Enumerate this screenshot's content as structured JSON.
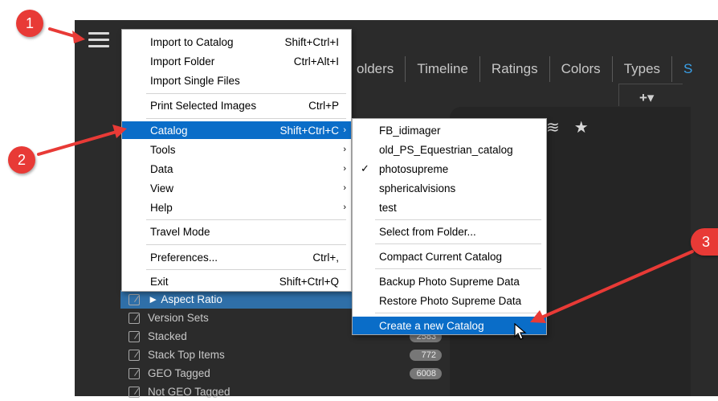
{
  "app": {
    "tabs": [
      "olders",
      "Timeline",
      "Ratings",
      "Colors",
      "Types",
      "S"
    ],
    "plus_label": "+▾"
  },
  "menu": {
    "items": [
      {
        "label": "Import to Catalog",
        "shortcut": "Shift+Ctrl+I"
      },
      {
        "label": "Import Folder",
        "shortcut": "Ctrl+Alt+I"
      },
      {
        "label": "Import Single Files",
        "shortcut": ""
      },
      {
        "label": "Print Selected Images",
        "shortcut": "Ctrl+P"
      },
      {
        "label": "Catalog",
        "shortcut": "Shift+Ctrl+C",
        "submenu": true,
        "highlighted": true
      },
      {
        "label": "Tools",
        "shortcut": "",
        "submenu": true
      },
      {
        "label": "Data",
        "shortcut": "",
        "submenu": true
      },
      {
        "label": "View",
        "shortcut": "",
        "submenu": true
      },
      {
        "label": "Help",
        "shortcut": "",
        "submenu": true
      },
      {
        "label": "Travel Mode",
        "shortcut": ""
      },
      {
        "label": "Preferences...",
        "shortcut": "Ctrl+,"
      },
      {
        "label": "Exit",
        "shortcut": "Shift+Ctrl+Q"
      }
    ],
    "arrow": "›"
  },
  "submenu": {
    "items": [
      {
        "label": "FB_idimager"
      },
      {
        "label": "old_PS_Equestrian_catalog"
      },
      {
        "label": "photosupreme",
        "checked": true
      },
      {
        "label": "sphericalvisions"
      },
      {
        "label": "test"
      },
      {
        "label": "Select from Folder..."
      },
      {
        "label": "Compact Current Catalog"
      },
      {
        "label": "Backup Photo Supreme Data"
      },
      {
        "label": "Restore Photo Supreme Data"
      },
      {
        "label": "Create a new Catalog",
        "highlighted": true
      }
    ],
    "check_glyph": "✓"
  },
  "sidebar": {
    "rows": [
      {
        "label": "► Aspect Ratio",
        "count": "",
        "selected": true
      },
      {
        "label": "Version Sets",
        "count": ""
      },
      {
        "label": "Stacked",
        "count": "2583"
      },
      {
        "label": "Stack Top Items",
        "count": "772"
      },
      {
        "label": "GEO Tagged",
        "count": "6008"
      },
      {
        "label": "Not GEO Tagged",
        "count": ""
      }
    ]
  },
  "markers": [
    "1",
    "2",
    "3"
  ],
  "colors": {
    "accent": "#0a6dc8",
    "marker": "#e83a36",
    "app_bg": "#2b2b2b"
  }
}
